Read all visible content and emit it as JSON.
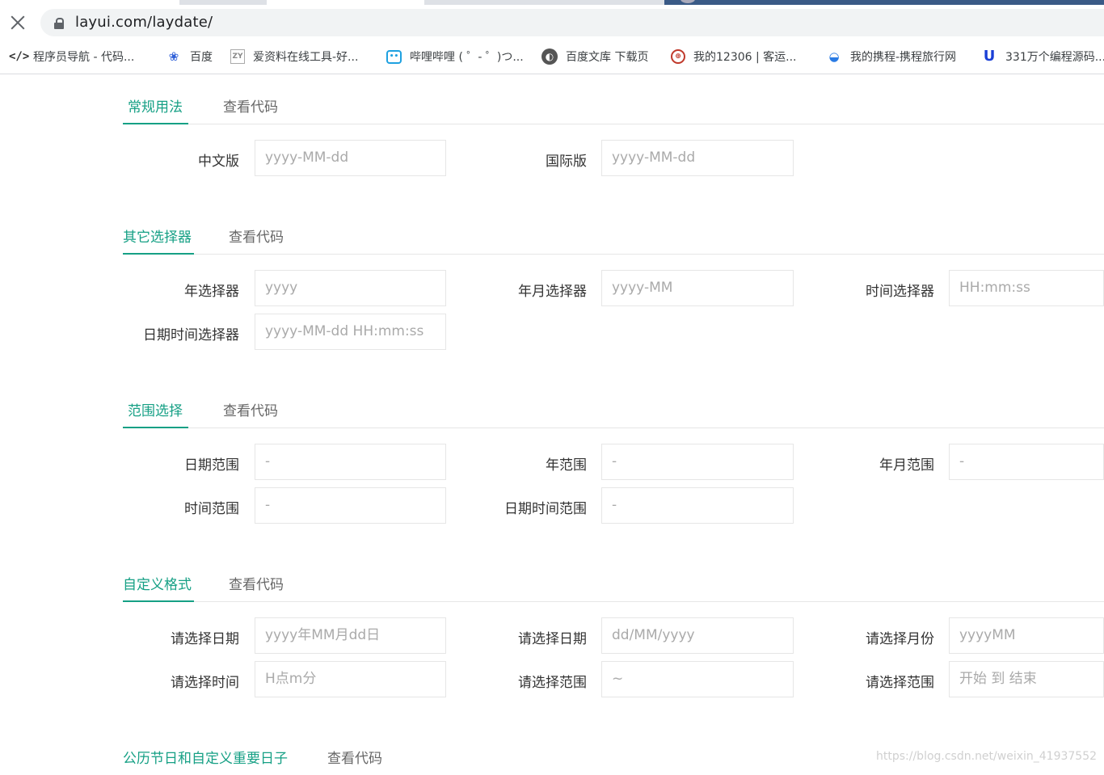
{
  "browser": {
    "url": "layui.com/laydate/",
    "bookmarks": [
      {
        "icon": "code-icon",
        "label": "程序员导航 - 代码..."
      },
      {
        "icon": "baidu-paw-icon",
        "label": "百度"
      },
      {
        "icon": "aiziliao-icon",
        "label": "爱资料在线工具-好..."
      },
      {
        "icon": "bilibili-icon",
        "label": "哔哩哔哩 ( ゜- ゜)つ..."
      },
      {
        "icon": "globe-icon",
        "label": "百度文库 下载页"
      },
      {
        "icon": "railway-icon",
        "label": "我的12306 | 客运..."
      },
      {
        "icon": "ctrip-icon",
        "label": "我的携程-携程旅行网"
      },
      {
        "icon": "u-icon",
        "label": "331万个编程源码..."
      }
    ]
  },
  "sections": [
    {
      "tabs": [
        "常规用法",
        "查看代码"
      ],
      "rows": [
        [
          {
            "label": "中文版",
            "placeholder": "yyyy-MM-dd"
          },
          {
            "label": "国际版",
            "placeholder": "yyyy-MM-dd"
          }
        ]
      ]
    },
    {
      "tabs": [
        "其它选择器",
        "查看代码"
      ],
      "rows": [
        [
          {
            "label": "年选择器",
            "placeholder": "yyyy"
          },
          {
            "label": "年月选择器",
            "placeholder": "yyyy-MM"
          },
          {
            "label": "时间选择器",
            "placeholder": "HH:mm:ss"
          }
        ],
        [
          {
            "label": "日期时间选择器",
            "placeholder": "yyyy-MM-dd HH:mm:ss"
          }
        ]
      ]
    },
    {
      "tabs": [
        "范围选择",
        "查看代码"
      ],
      "rows": [
        [
          {
            "label": "日期范围",
            "placeholder": "-"
          },
          {
            "label": "年范围",
            "placeholder": "-"
          },
          {
            "label": "年月范围",
            "placeholder": "-"
          }
        ],
        [
          {
            "label": "时间范围",
            "placeholder": "-"
          },
          {
            "label": "日期时间范围",
            "placeholder": "-"
          }
        ]
      ]
    },
    {
      "tabs": [
        "自定义格式",
        "查看代码"
      ],
      "rows": [
        [
          {
            "label": "请选择日期",
            "placeholder": "yyyy年MM月dd日"
          },
          {
            "label": "请选择日期",
            "placeholder": "dd/MM/yyyy"
          },
          {
            "label": "请选择月份",
            "placeholder": "yyyyMM"
          }
        ],
        [
          {
            "label": "请选择时间",
            "placeholder": "H点m分"
          },
          {
            "label": "请选择范围",
            "placeholder": "~"
          },
          {
            "label": "请选择范围",
            "placeholder": "开始 到 结束"
          }
        ]
      ]
    },
    {
      "tabs": [
        "公历节日和自定义重要日子",
        "查看代码"
      ],
      "rows": []
    }
  ],
  "watermark": "https://blog.csdn.net/weixin_41937552",
  "colors": {
    "accent": "#16a085",
    "border": "#e6e6e6",
    "placeholder": "#aaaaaa"
  }
}
